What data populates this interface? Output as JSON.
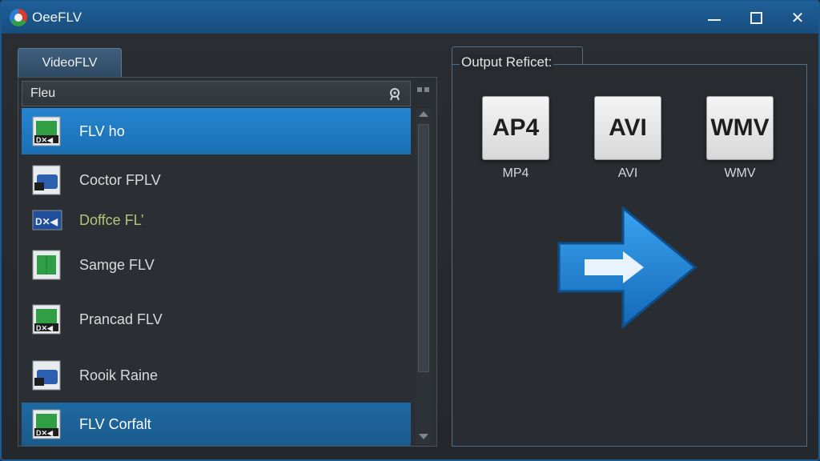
{
  "window": {
    "title": "OeeFLV",
    "controls": [
      "minimize-icon",
      "maximize-icon",
      "close-icon"
    ],
    "close_glyph": "✕"
  },
  "left": {
    "tab_label": "VideoFLV",
    "list_header": "Fleu",
    "files": [
      {
        "label": "FLV ho",
        "icon": "flv-file-green-icon",
        "state": "selected"
      },
      {
        "label": "Coctor FPLV",
        "icon": "flv-file-blue-icon",
        "state": "normal"
      },
      {
        "label": "Doffce FL’",
        "icon": "flv-file-strip-icon",
        "state": "normal"
      },
      {
        "label": "Samge FLV",
        "icon": "flv-file-green-icon",
        "state": "normal"
      },
      {
        "label": "Pranсad FLV",
        "icon": "flv-file-green-icon",
        "state": "normal"
      },
      {
        "label": "Rooik Raine",
        "icon": "flv-file-blue-icon",
        "state": "normal"
      },
      {
        "label": "FLV Corfalt",
        "icon": "flv-file-green-icon",
        "state": "selected"
      }
    ]
  },
  "right": {
    "title": "Output Reficet:",
    "formats": [
      {
        "tile": "AP4",
        "label": "MP4"
      },
      {
        "tile": "AVI",
        "label": "AVI"
      },
      {
        "tile": "WMV",
        "label": "WMV"
      }
    ],
    "convert_icon": "convert-arrow-icon"
  },
  "colors": {
    "titlebar": "#1f5f98",
    "selection": "#2585d0",
    "arrow": "#1f8be0"
  }
}
